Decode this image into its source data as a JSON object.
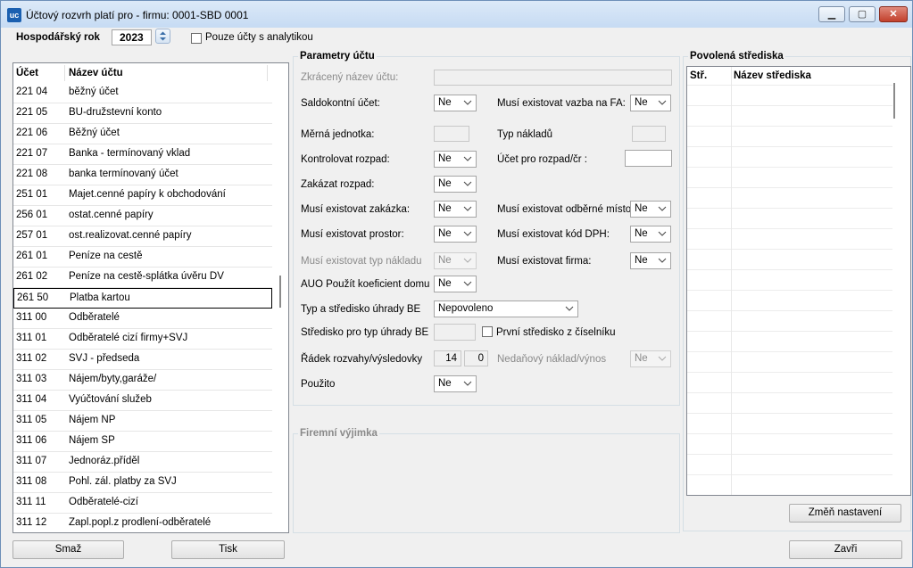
{
  "window": {
    "title": "Účtový rozvrh platí pro - firmu: 0001-SBD 0001",
    "icon_text": "uc",
    "minimize": "▁",
    "maximize": "▢",
    "close": "✕"
  },
  "top": {
    "year_label": "Hospodářský rok",
    "year_value": "2023",
    "only_analytic_label": "Pouze účty s analytikou"
  },
  "accounts": {
    "col_account": "Účet",
    "col_name": "Název účtu",
    "rows": [
      {
        "account": "221 04",
        "name": "běžný účet"
      },
      {
        "account": "221 05",
        "name": "BU-družstevní konto"
      },
      {
        "account": "221 06",
        "name": "Běžný účet"
      },
      {
        "account": "221 07",
        "name": "Banka - termínovaný vklad"
      },
      {
        "account": "221 08",
        "name": "banka termínovaný účet"
      },
      {
        "account": "251 01",
        "name": "Majet.cenné papíry k obchodování"
      },
      {
        "account": "256 01",
        "name": "ostat.cenné papíry"
      },
      {
        "account": "257 01",
        "name": "ost.realizovat.cenné papíry"
      },
      {
        "account": "261 01",
        "name": "Peníze na cestě"
      },
      {
        "account": "261 02",
        "name": "Peníze na cestě-splátka úvěru DV"
      },
      {
        "account": "261 50",
        "name": "Platba kartou"
      },
      {
        "account": "311 00",
        "name": "Odběratelé"
      },
      {
        "account": "311 01",
        "name": "Odběratelé cizí firmy+SVJ"
      },
      {
        "account": "311 02",
        "name": "SVJ - předseda"
      },
      {
        "account": "311 03",
        "name": "Nájem/byty,garáže/"
      },
      {
        "account": "311 04",
        "name": "Vyúčtování služeb"
      },
      {
        "account": "311 05",
        "name": "Nájem NP"
      },
      {
        "account": "311 06",
        "name": "Nájem SP"
      },
      {
        "account": "311 07",
        "name": "Jednoráz.příděl"
      },
      {
        "account": "311 08",
        "name": "Pohl. zál. platby za SVJ"
      },
      {
        "account": "311 11",
        "name": "Odběratelé-cizí"
      },
      {
        "account": "311 12",
        "name": "Zapl.popl.z prodlení-odběratelé"
      }
    ]
  },
  "params": {
    "group_title": "Parametry účtu",
    "short_name_label": "Zkrácený název účtu:",
    "saldo_label": "Saldokontní účet:",
    "saldo_value": "Ne",
    "fa_label": "Musí existovat vazba na FA:",
    "fa_value": "Ne",
    "unit_label": "Měrná jednotka:",
    "cost_type_label": "Typ nákladů",
    "check_split_label": "Kontrolovat rozpad:",
    "check_split_value": "Ne",
    "split_account_label": "Účet pro rozpad/čr :",
    "forbid_split_label": "Zakázat rozpad:",
    "forbid_split_value": "Ne",
    "order_label": "Musí existovat zakázka:",
    "order_value": "Ne",
    "place_label": "Musí existovat odběrné místo:",
    "place_value": "Ne",
    "space_label": "Musí existovat prostor:",
    "space_value": "Ne",
    "vat_label": "Musí existovat kód DPH:",
    "vat_value": "Ne",
    "cost_exist_label": "Musí existovat typ nákladu",
    "cost_exist_value": "Ne",
    "firm_label": "Musí existovat firma:",
    "firm_value": "Ne",
    "auo_label": "AUO Použít koeficient domu",
    "auo_value": "Ne",
    "be_type_label": "Typ a středisko úhrady BE",
    "be_type_value": "Nepovoleno",
    "be_center_label": "Středisko pro typ úhrady BE",
    "first_center_label": "První středisko z číselníku",
    "row_label": "Řádek rozvahy/výsledovky",
    "row_value_1": "14",
    "row_value_2": "0",
    "nontax_label": "Nedaňový náklad/výnos",
    "nontax_value": "Ne",
    "used_label": "Použito",
    "used_value": "Ne"
  },
  "exception": {
    "group_title": "Firemní výjimka"
  },
  "centers": {
    "group_title": "Povolená střediska",
    "col_code": "Stř.",
    "col_name": "Název střediska",
    "change_button": "Změň nastavení"
  },
  "buttons": {
    "delete": "Smaž",
    "print": "Tisk",
    "close": "Zavři"
  }
}
